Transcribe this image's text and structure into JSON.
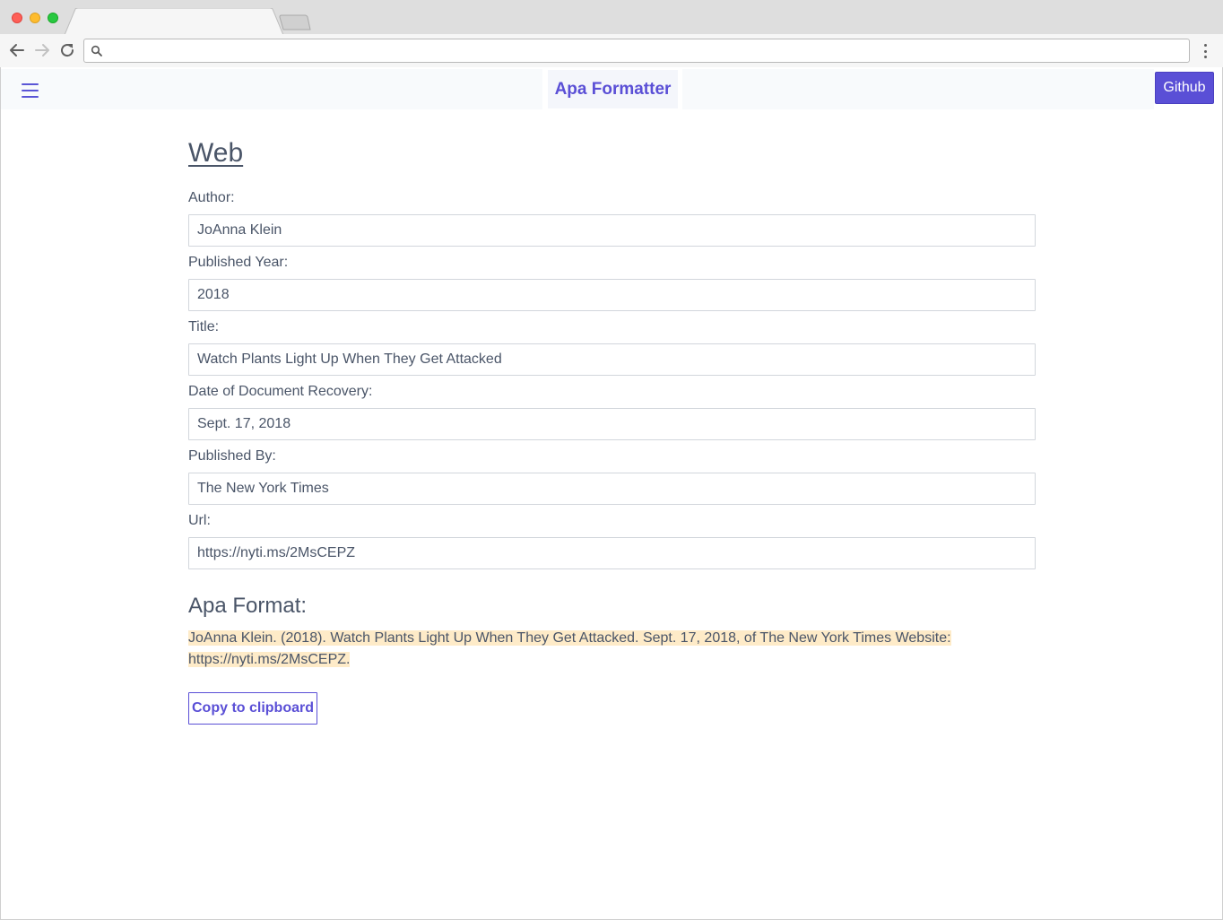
{
  "browser": {
    "tab_title": "",
    "address": ""
  },
  "navbar": {
    "brand": "Apa Formatter",
    "github_label": "Github",
    "accent_color": "#5a4fd6"
  },
  "form": {
    "heading": "Web",
    "fields": [
      {
        "label": "Author:",
        "value": "JoAnna Klein"
      },
      {
        "label": "Published Year:",
        "value": "2018"
      },
      {
        "label": "Title:",
        "value": "Watch Plants Light Up When They Get Attacked"
      },
      {
        "label": "Date of Document Recovery:",
        "value": "Sept. 17, 2018"
      },
      {
        "label": "Published By:",
        "value": "The New York Times"
      },
      {
        "label": "Url:",
        "value": "https://nyti.ms/2MsCEPZ"
      }
    ]
  },
  "result": {
    "heading": "Apa Format:",
    "text": "JoAnna Klein. (2018). Watch Plants Light Up When They Get Attacked. Sept. 17, 2018, of The New York Times Website: https://nyti.ms/2MsCEPZ.",
    "highlight_color": "#feebc8",
    "copy_label": "Copy to clipboard"
  }
}
